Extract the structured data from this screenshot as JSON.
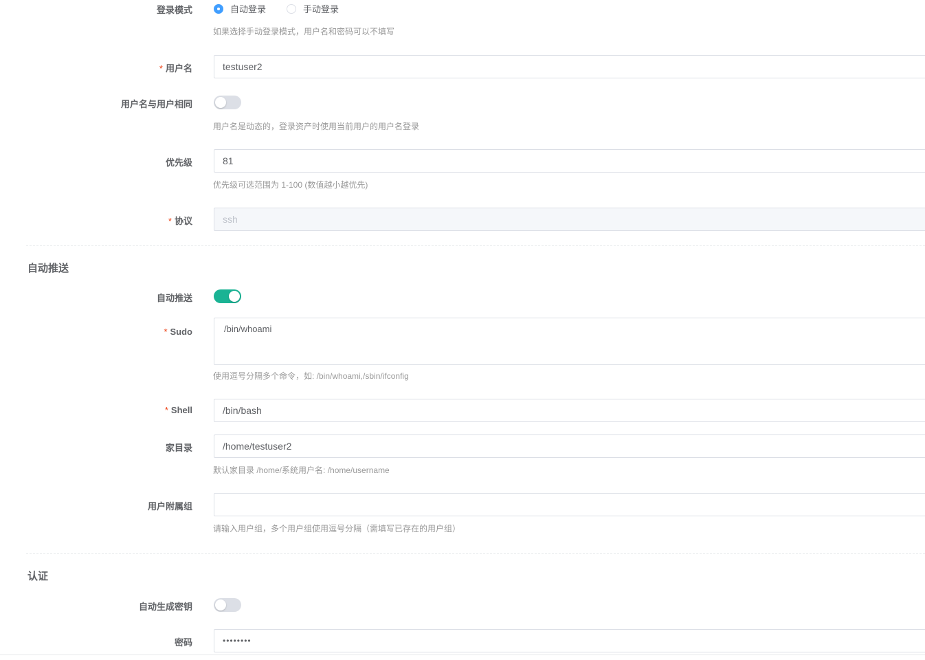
{
  "login_mode": {
    "label": "登录模式",
    "options": [
      "自动登录",
      "手动登录"
    ],
    "selected": "自动登录",
    "hint": "如果选择手动登录模式，用户名和密码可以不填写"
  },
  "username": {
    "label": "用户名",
    "value": "testuser2"
  },
  "username_same": {
    "label": "用户名与用户相同",
    "enabled": false,
    "hint": "用户名是动态的，登录资产时使用当前用户的用户名登录"
  },
  "priority": {
    "label": "优先级",
    "value": "81",
    "hint": "优先级可选范围为 1-100 (数值越小越优先)"
  },
  "protocol": {
    "label": "协议",
    "value": "ssh"
  },
  "auto_push_section": {
    "title": "自动推送"
  },
  "auto_push": {
    "label": "自动推送",
    "enabled": true
  },
  "sudo": {
    "label": "Sudo",
    "value": "/bin/whoami",
    "hint": "使用逗号分隔多个命令，如: /bin/whoami,/sbin/ifconfig"
  },
  "shell": {
    "label": "Shell",
    "value": "/bin/bash"
  },
  "home": {
    "label": "家目录",
    "value": "/home/testuser2",
    "hint": "默认家目录 /home/系统用户名: /home/username"
  },
  "groups": {
    "label": "用户附属组",
    "value": "",
    "hint": "请输入用户组，多个用户组使用逗号分隔（需填写已存在的用户组）"
  },
  "auth_section": {
    "title": "认证"
  },
  "auto_key": {
    "label": "自动生成密钥",
    "enabled": false
  },
  "password": {
    "label": "密码",
    "value": "••••••••"
  },
  "required_mark": "*",
  "colors": {
    "accent": "#1ab394",
    "radio_checked": "#409eff",
    "required": "#ed4014"
  }
}
